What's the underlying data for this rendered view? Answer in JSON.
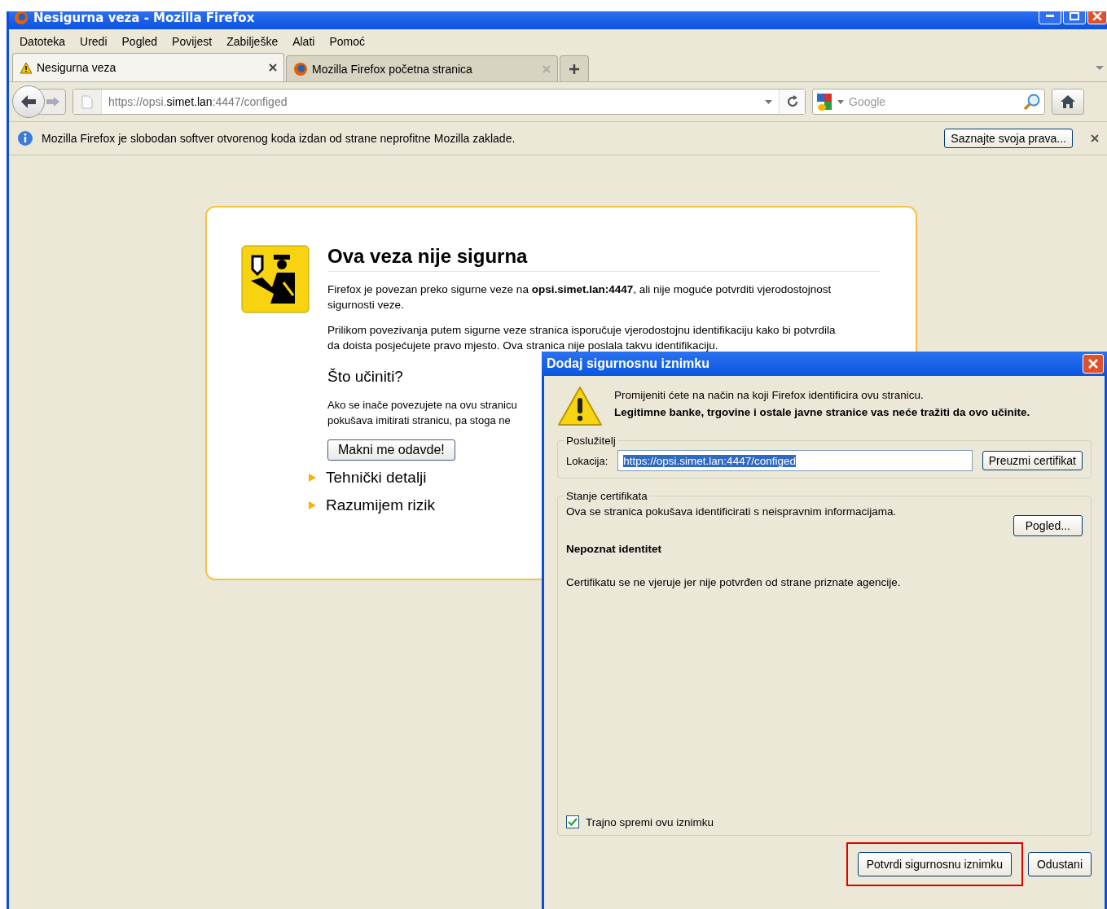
{
  "window": {
    "title": "Nesigurna veza - Mozilla Firefox"
  },
  "menu": [
    "Datoteka",
    "Uredi",
    "Pogled",
    "Povijest",
    "Zabilješke",
    "Alati",
    "Pomoć"
  ],
  "tabs": [
    {
      "label": "Nesigurna veza",
      "selected": true,
      "kind": "warning"
    },
    {
      "label": "Mozilla Firefox početna stranica",
      "selected": false,
      "kind": "firefox"
    }
  ],
  "address": {
    "scheme": "https://opsi.",
    "host": "simet.lan",
    ":port_path": ":4447/configed"
  },
  "search": {
    "placeholder": "Google"
  },
  "infobar": {
    "message": "Mozilla Firefox je slobodan softver otvorenog koda izdan od strane neprofitne Mozilla zaklade.",
    "button": "Saznajte svoja prava..."
  },
  "error_page": {
    "title": "Ova veza nije sigurna",
    "paragraph_1": "Firefox je povezan preko sigurne veze na **opsi.simet.lan:4447**, ali nije moguće potvrditi vjerodostojnost sigurnosti veze.",
    "paragraph_2": "Prilikom povezivanja putem sigurne veze stranica isporučuje vjerodostojnu identifikaciju kako bi potvrdila da doista posjećujete pravo mjesto. Ova stranica nije poslala takvu identifikaciju.",
    "heading": "Što učiniti?",
    "paragraph_3_lines": [
      "Ako se inače povezujete na ovu stranicu",
      "pokušava imitirati stranicu, pa stoga ne"
    ],
    "button": "Makni me odavde!",
    "sections": [
      {
        "label": "Tehnički detalji",
        "expanded": false
      },
      {
        "label": "Razumijem rizik",
        "expanded": false
      }
    ]
  },
  "dialog": {
    "title": "Dodaj sigurnosnu iznimku",
    "intro": "Promijeniti ćete na način na koji Firefox identificira ovu stranicu.",
    "warning": "Legitimne banke, trgovine i ostale javne stranice vas neće tražiti da ovo učinite.",
    "server_group": "Poslužitelj",
    "location_label": "Lokacija:",
    "location_value": "https://opsi.simet.lan:4447/configed",
    "get_certificate": "Preuzmi certifikat",
    "status_group": "Stanje certifikata",
    "status_text": "Ova se stranica pokušava identificirati s neispravnim informacijama.",
    "view_button": "Pogled...",
    "identity_heading": "Nepoznat identitet",
    "identity_text": "Certifikatu se ne vjeruje jer nije potvrđen od strane priznate agencije.",
    "permanent": {
      "label": "Trajno spremi ovu iznimku",
      "checked": true
    },
    "confirm": {
      "label": "Potvrdi sigurnosnu iznimku",
      "highlighted": true
    },
    "cancel": "Odustani"
  }
}
